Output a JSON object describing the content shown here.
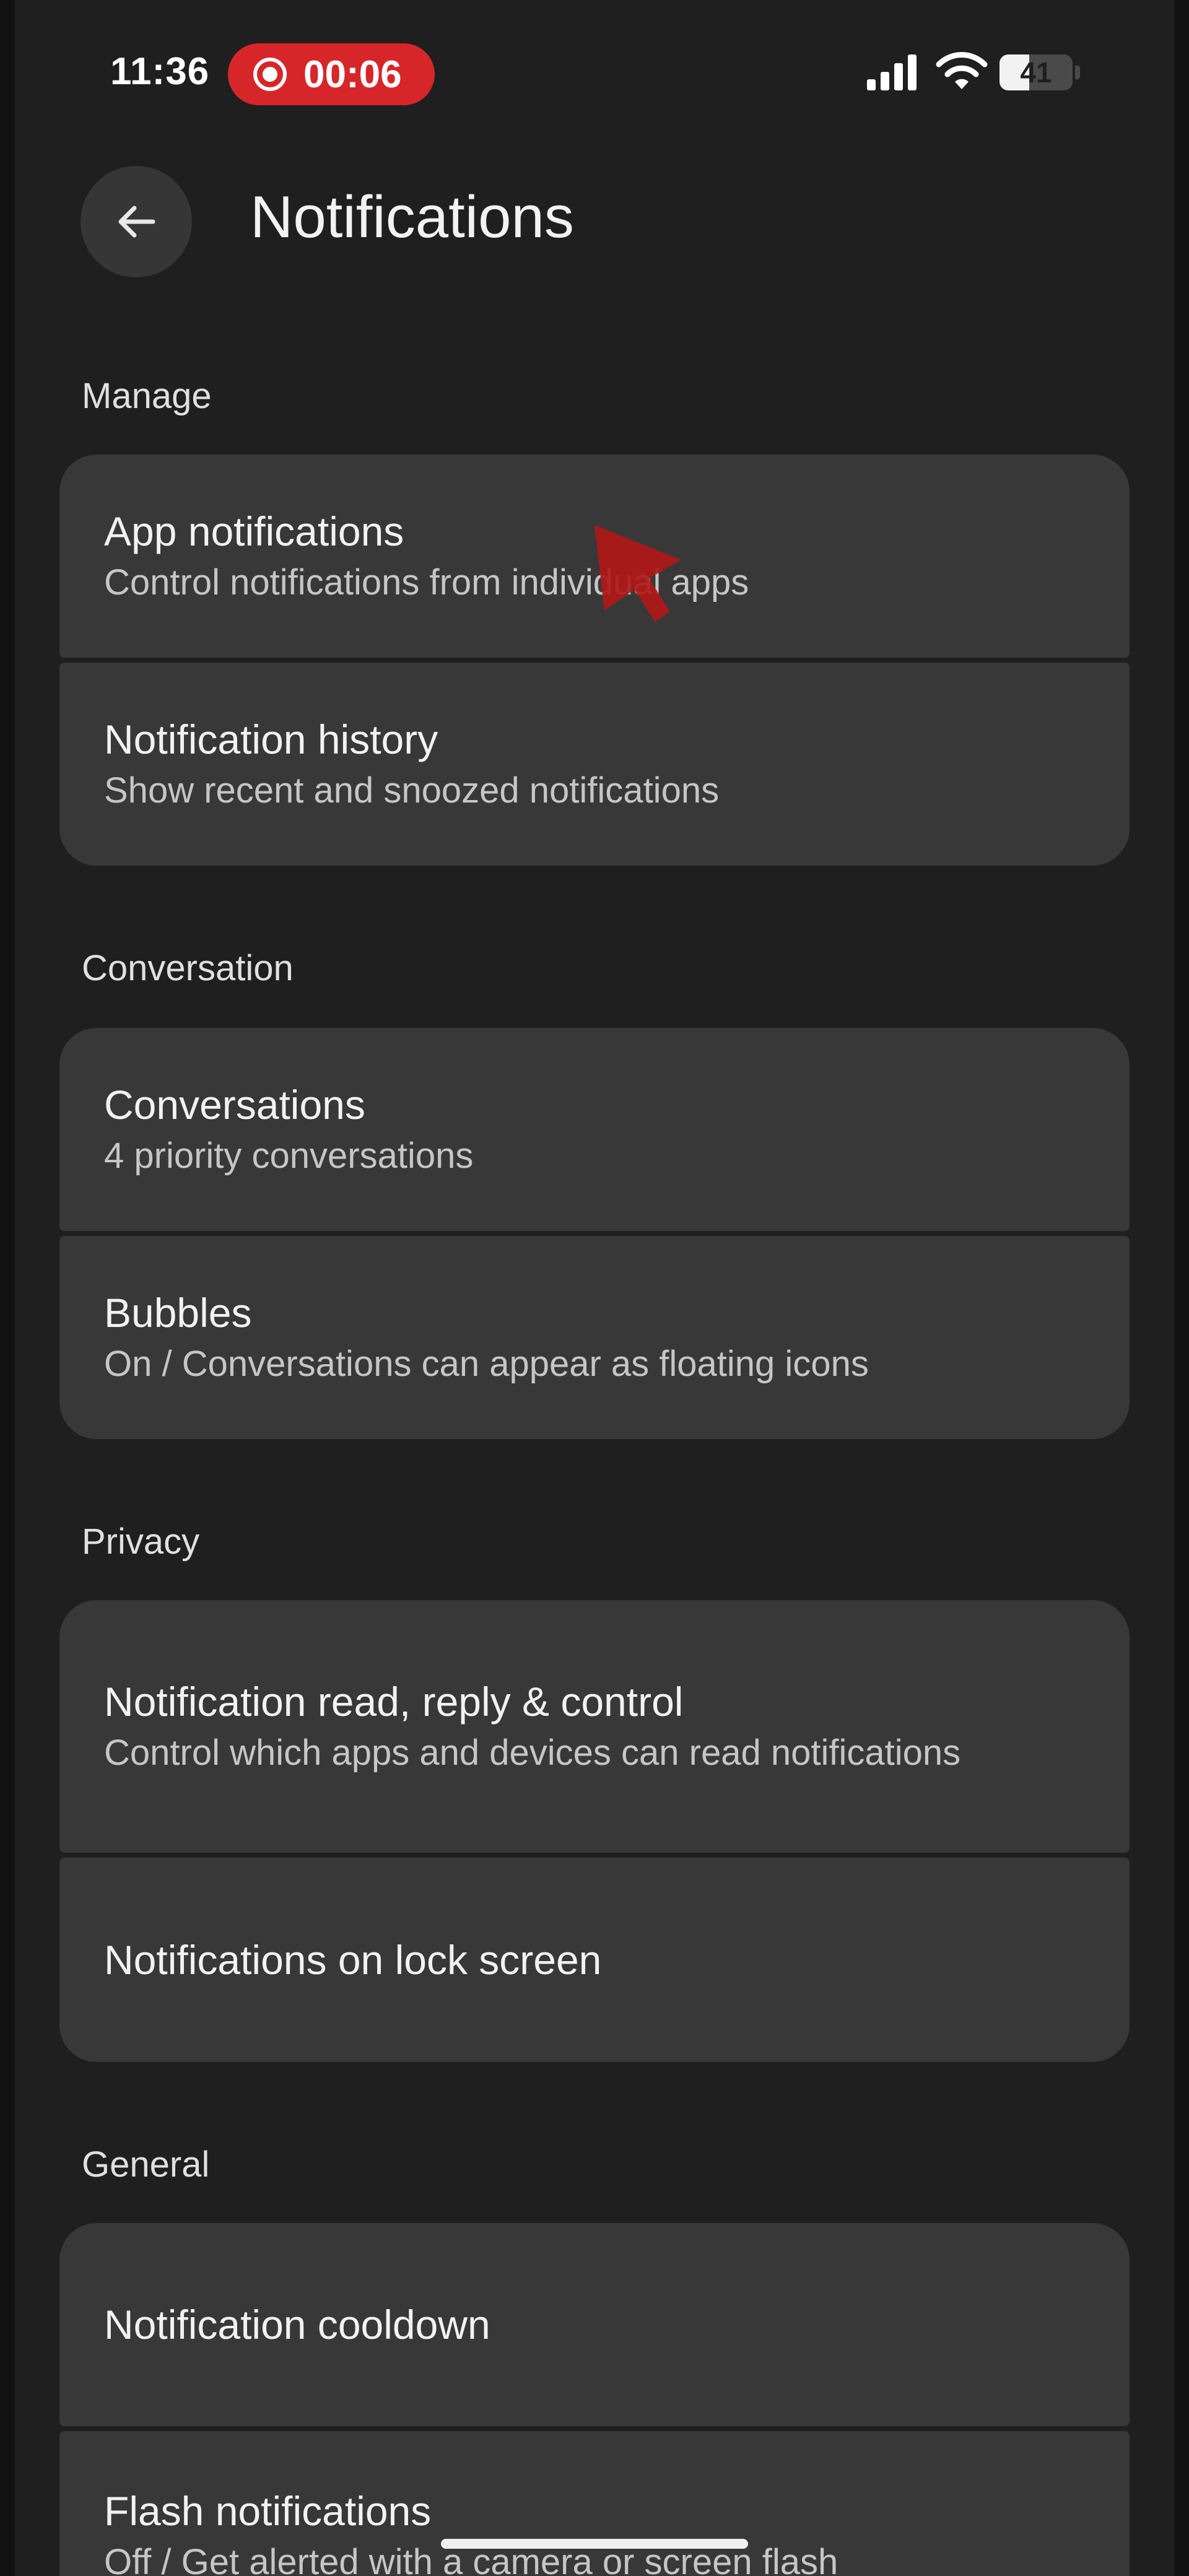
{
  "status_bar": {
    "time": "11:36",
    "recording_time": "00:06",
    "recording_color": "#d6262a",
    "battery_level": "41",
    "battery_fraction": 0.41,
    "signal_icon": "signal-bars-icon",
    "wifi_icon": "wifi-icon"
  },
  "header": {
    "back_icon": "arrow-left-icon",
    "title": "Notifications"
  },
  "sections": {
    "manage": {
      "label": "Manage",
      "items": [
        {
          "title": "App notifications",
          "summary": "Control notifications from individual apps"
        },
        {
          "title": "Notification history",
          "summary": "Show recent and snoozed notifications"
        }
      ]
    },
    "conversation": {
      "label": "Conversation",
      "items": [
        {
          "title": "Conversations",
          "summary": "4 priority conversations"
        },
        {
          "title": "Bubbles",
          "summary": "On / Conversations can appear as floating icons"
        }
      ]
    },
    "privacy": {
      "label": "Privacy",
      "items": [
        {
          "title": "Notification read, reply & control",
          "summary": "Control which apps and devices can read notifications"
        },
        {
          "title": "Notifications on lock screen"
        }
      ]
    },
    "general": {
      "label": "General",
      "items": [
        {
          "title": "Notification cooldown"
        },
        {
          "title": "Flash notifications",
          "summary": "Off / Get alerted with a camera or screen flash"
        }
      ]
    }
  },
  "theme": {
    "background": "#1f1f1f",
    "card": "#383838",
    "cursor_color": "#b01818"
  }
}
